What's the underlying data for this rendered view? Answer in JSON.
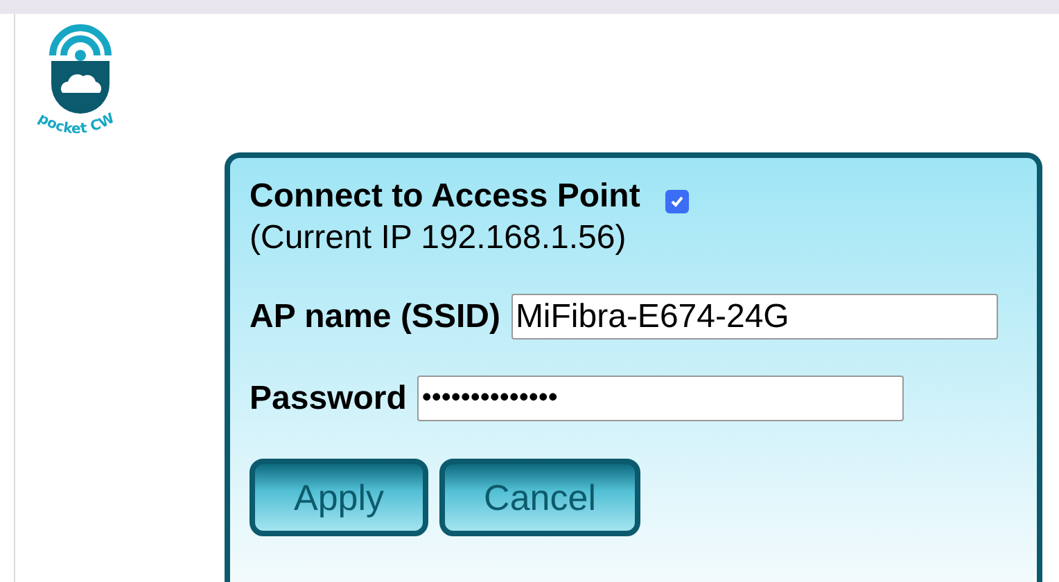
{
  "logo": {
    "text": "pocket CW"
  },
  "form": {
    "title": "Connect to Access Point",
    "connect": {
      "checked": true
    },
    "subtitle": "(Current IP 192.168.1.56)",
    "ssid": {
      "label": "AP name (SSID)",
      "value": "MiFibra-E674-24G"
    },
    "password": {
      "label": "Password",
      "value": "••••••••••••••"
    },
    "buttons": [
      "Apply",
      "Cancel"
    ]
  }
}
